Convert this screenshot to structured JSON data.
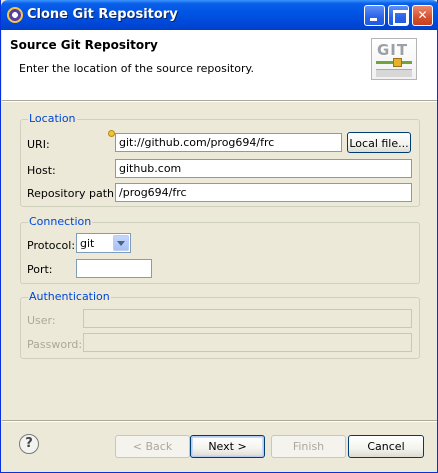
{
  "window": {
    "title": "Clone Git Repository",
    "controls": {
      "minimize": "",
      "maximize": "",
      "close": "✕"
    }
  },
  "header": {
    "title": "Source Git Repository",
    "description": "Enter the location of the source repository.",
    "logo_text": "GIT"
  },
  "location": {
    "group_title": "Location",
    "uri_label": "URI:",
    "uri_value": "git://github.com/prog694/frc",
    "local_file_label": "Local file...",
    "host_label": "Host:",
    "host_value": "github.com",
    "repo_path_label": "Repository path:",
    "repo_path_value": "/prog694/frc"
  },
  "connection": {
    "group_title": "Connection",
    "protocol_label": "Protocol:",
    "protocol_value": "git",
    "port_label": "Port:",
    "port_value": ""
  },
  "authentication": {
    "group_title": "Authentication",
    "user_label": "User:",
    "user_value": "",
    "password_label": "Password:",
    "password_value": ""
  },
  "footer": {
    "help_glyph": "?",
    "back_label": "< Back",
    "next_label": "Next >",
    "finish_label": "Finish",
    "cancel_label": "Cancel"
  },
  "colors": {
    "titlebar": "#0055e5",
    "group_title": "#0046d5",
    "dialog_bg": "#ece9d8"
  }
}
